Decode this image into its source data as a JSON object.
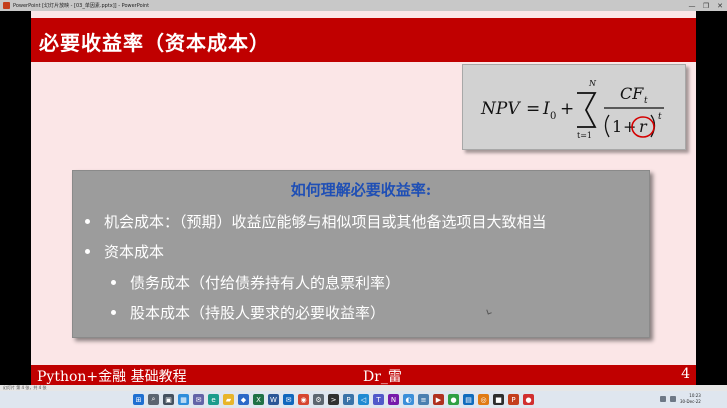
{
  "window": {
    "title": "PowerPoint [幻灯片放映 - [03_单因素.pptx]] - PowerPoint",
    "controls": [
      "—",
      "❐",
      "✕"
    ]
  },
  "slide": {
    "title": "必要收益率（资本成本）",
    "formula": {
      "lhs": "NPV",
      "equals": "=",
      "i0": "I",
      "i0_sub": "0",
      "plus": "+",
      "sum_sup": "N",
      "sum_sub": "t=1",
      "numerator": "CF",
      "numerator_sub": "t",
      "den_one": "1",
      "den_plus": "+",
      "den_r": "r",
      "den_exp": "t"
    },
    "box_heading": "如何理解必要收益率:",
    "bullets": [
      {
        "text": "机会成本：（预期）收益应能够与相似项目或其他备选项目大致相当",
        "level": 1
      },
      {
        "text": "资本成本",
        "level": 1
      },
      {
        "text": "债务成本（付给债券持有人的息票利率）",
        "level": 2
      },
      {
        "text": "股本成本（持股人要求的必要收益率）",
        "level": 2
      }
    ],
    "footer": {
      "course": "Python+金融 基础教程",
      "author": "Dr_雷",
      "page": "4"
    }
  },
  "statusbar": {
    "text": "幻灯片 第 4 张，共 4 张"
  },
  "taskbar": {
    "icons": [
      {
        "name": "start-icon",
        "glyph": "⊞",
        "color": "#1f6fd1"
      },
      {
        "name": "search-icon",
        "glyph": "⌕",
        "color": "#5b6470"
      },
      {
        "name": "task-view-icon",
        "glyph": "▣",
        "color": "#44505e"
      },
      {
        "name": "widgets-icon",
        "glyph": "▦",
        "color": "#2e8ddb"
      },
      {
        "name": "chat-icon",
        "glyph": "✉",
        "color": "#6264a7"
      },
      {
        "name": "edge-icon",
        "glyph": "e",
        "color": "#1a9c8c"
      },
      {
        "name": "file-explorer-icon",
        "glyph": "▰",
        "color": "#e8b52a"
      },
      {
        "name": "store-icon",
        "glyph": "◆",
        "color": "#2b68c7"
      },
      {
        "name": "excel-icon",
        "glyph": "X",
        "color": "#1e7145"
      },
      {
        "name": "word-icon",
        "glyph": "W",
        "color": "#2b5797"
      },
      {
        "name": "mail-icon",
        "glyph": "✉",
        "color": "#1067bd"
      },
      {
        "name": "chrome-icon",
        "glyph": "◉",
        "color": "#d6452f"
      },
      {
        "name": "settings-icon",
        "glyph": "⚙",
        "color": "#5c6670"
      },
      {
        "name": "terminal-icon",
        "glyph": ">",
        "color": "#303030"
      },
      {
        "name": "python-icon",
        "glyph": "P",
        "color": "#3a73a8"
      },
      {
        "name": "vscode-icon",
        "glyph": "◁",
        "color": "#1f8ad2"
      },
      {
        "name": "teams-icon",
        "glyph": "T",
        "color": "#5059c9"
      },
      {
        "name": "onenote-icon",
        "glyph": "N",
        "color": "#7719aa"
      },
      {
        "name": "photos-icon",
        "glyph": "◐",
        "color": "#3b8fd9"
      },
      {
        "name": "notepad-icon",
        "glyph": "≡",
        "color": "#4a7fb0"
      },
      {
        "name": "media-icon",
        "glyph": "▶",
        "color": "#b0311f"
      },
      {
        "name": "green-app-icon",
        "glyph": "●",
        "color": "#2fa043"
      },
      {
        "name": "calendar-icon",
        "glyph": "▤",
        "color": "#0f6cbd"
      },
      {
        "name": "browser-icon",
        "glyph": "◎",
        "color": "#e07a12"
      },
      {
        "name": "dark-app-icon",
        "glyph": "■",
        "color": "#2d2d2d"
      },
      {
        "name": "powerpoint-icon",
        "glyph": "P",
        "color": "#c43e1c"
      },
      {
        "name": "record-icon",
        "glyph": "●",
        "color": "#d12f2f"
      }
    ],
    "clock_time": "10:23",
    "clock_date": "30-Dec-22"
  }
}
